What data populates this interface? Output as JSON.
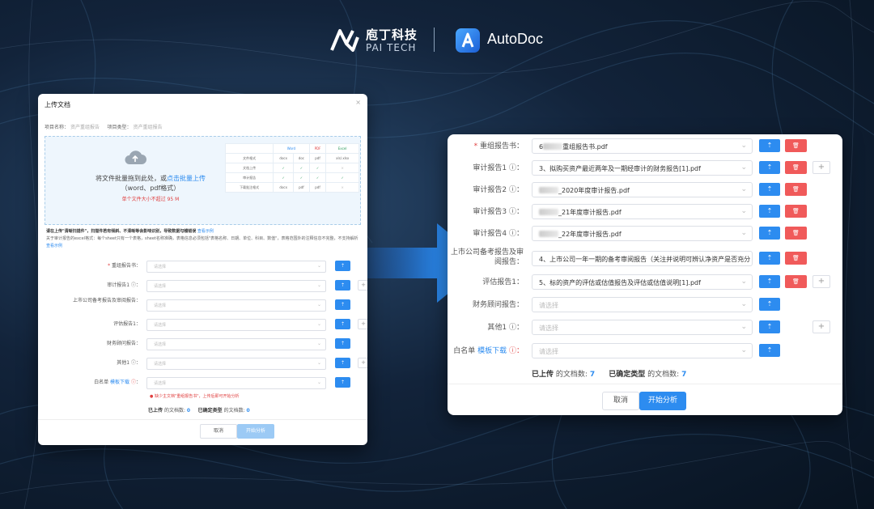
{
  "brand": {
    "company_cn": "庖丁科技",
    "company_en": "PAI TECH",
    "product": "AutoDoc"
  },
  "left_dialog": {
    "title": "上传文档",
    "close": "×",
    "project_name_label": "项目名称：",
    "project_name_value": "资产重组报告",
    "project_type_label": "项目类型：",
    "project_type_value": "资产重组报告",
    "drop_text": "将文件批量拖到此处，或",
    "drop_link": "点击批量上传",
    "drop_formats": "（word、pdf格式）",
    "drop_limit": "单个文件大小不超过 95 M",
    "format_table": {
      "headers": [
        "",
        "Word",
        "PDF",
        "Excel"
      ],
      "rows": [
        [
          "文件格式",
          "docx",
          "doc",
          "pdf",
          "xls/.xlsx"
        ],
        [
          "文档上传",
          "✓",
          "✓",
          "✓",
          "×"
        ],
        [
          "审计报告",
          "✓",
          "✓",
          "✓",
          "✓"
        ],
        [
          "下载批注格式",
          "docx",
          "pdf",
          "pdf",
          "×"
        ]
      ]
    },
    "notice_title": "请在上传\"清晰扫描件\"，扫描件若有倾斜、不清晰等会影响识别，导致数据勾稽错误",
    "notice_link": "查看示例",
    "notice_body": "关于审计报告的excel格式：每个sheet只有一个表格，sheet名称准确，表格信息必须包括\"表格名称、日期、单位、科目、数值\"，表格范围外的注释信息不完整，不支持解析",
    "notice_link2": "查看示例",
    "rows": [
      {
        "label": "重组报告书：",
        "required": true,
        "placeholder": "请选择",
        "plus": false
      },
      {
        "label": "审计报告1 ⓘ：",
        "placeholder": "请选择",
        "plus": true
      },
      {
        "label": "上市公司备考报告及审阅报告：",
        "placeholder": "请选择",
        "plus": false,
        "two_line": true
      },
      {
        "label": "评估报告1：",
        "placeholder": "请选择",
        "plus": true
      },
      {
        "label": "财务顾问报告：",
        "placeholder": "请选择",
        "plus": false
      },
      {
        "label": "其他1 ⓘ：",
        "placeholder": "请选择",
        "plus": true
      },
      {
        "label": "白名单",
        "link": "模板下载",
        "placeholder": "请选择",
        "plus": false
      }
    ],
    "warning": "● 缺少主文档\"重组报告书\"，上传后即可开始分析",
    "uploaded_label": "已上传",
    "uploaded_suffix": "的文档数:",
    "uploaded_count": "0",
    "typed_label": "已确定类型",
    "typed_suffix": "的文档数:",
    "typed_count": "0",
    "cancel": "取消",
    "start": "开始分析"
  },
  "right_dialog": {
    "rows": [
      {
        "label": "重组报告书：",
        "required": true,
        "prefix": "6",
        "value": "重组报告书.pdf",
        "del": true,
        "plus": false
      },
      {
        "label": "审计报告1 ⓘ：",
        "value": "3、拟购买资产最近两年及一期经审计的财务报告[1].pdf",
        "del": true,
        "plus": true
      },
      {
        "label": "审计报告2 ⓘ：",
        "value": "_2020年度审计报告.pdf",
        "blur": true,
        "del": true,
        "plus": false
      },
      {
        "label": "审计报告3 ⓘ：",
        "value": "_21年度审计报告.pdf",
        "blur": true,
        "del": true,
        "plus": false
      },
      {
        "label": "审计报告4 ⓘ：",
        "value": "_22年度审计报告.pdf",
        "blur": true,
        "del": true,
        "plus": false
      },
      {
        "label": "上市公司备考报告及审阅报告：",
        "value": "4、上市公司一年一期的备考审阅报告（关注并说明可辨认净资产是否充分",
        "del": true,
        "plus": false,
        "two_line": true
      },
      {
        "label": "评估报告1：",
        "value": "5、标的资产的评估或估值报告及评估或估值说明[1].pdf",
        "del": true,
        "plus": true
      },
      {
        "label": "财务顾问报告：",
        "placeholder": "请选择",
        "del": false,
        "plus": false
      },
      {
        "label": "其他1 ⓘ：",
        "placeholder": "请选择",
        "del": false,
        "plus": true
      },
      {
        "label": "白名单",
        "link": "模板下载",
        "info": " ⓘ：",
        "placeholder": "请选择",
        "del": false,
        "plus": false
      }
    ],
    "uploaded_label": "已上传",
    "uploaded_suffix": "的文档数:",
    "uploaded_count": "7",
    "typed_label": "已确定类型",
    "typed_suffix": "的文档数:",
    "typed_count": "7",
    "cancel": "取消",
    "start": "开始分析"
  },
  "colors": {
    "accent": "#2d8cf0",
    "danger": "#f05a5a",
    "background": "#12233a"
  }
}
